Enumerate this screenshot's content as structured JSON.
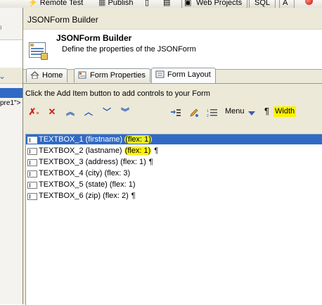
{
  "ide": {
    "toolbar": {
      "remote_test": "Remote Test",
      "publish": "Publish",
      "web_projects": "Web Projects",
      "sql": "SQL"
    },
    "left": {
      "code_fragment": "pre1\">",
      "snippet": "o"
    }
  },
  "dialog": {
    "title": "JSONForm Builder",
    "banner": {
      "heading": "JSONForm Builder",
      "description": "Define the properties of the JSONForm"
    },
    "tabs": [
      {
        "label": "Home",
        "icon": "home-icon",
        "active": false
      },
      {
        "label": "Form Properties",
        "icon": "form-properties-icon",
        "active": false
      },
      {
        "label": "Form Layout",
        "icon": "form-layout-icon",
        "active": true
      }
    ],
    "hint": "Click the Add Item button to add controls to your Form",
    "toolbar": {
      "menu_label": "Menu",
      "pilcrow": "¶",
      "width_label": "Width"
    },
    "items": [
      {
        "name": "TEXTBOX_1 (firstname)",
        "flex": "(flex: 1)",
        "pilcrow": "",
        "selected": true,
        "highlight": true
      },
      {
        "name": "TEXTBOX_2 (lastname)",
        "flex": "(flex: 1)",
        "pilcrow": "¶",
        "selected": false,
        "highlight": true
      },
      {
        "name": "TEXTBOX_3 (address)",
        "flex": "(flex: 1)",
        "pilcrow": "¶",
        "selected": false,
        "highlight": false
      },
      {
        "name": "TEXTBOX_4 (city)",
        "flex": "(flex: 3)",
        "pilcrow": "",
        "selected": false,
        "highlight": false
      },
      {
        "name": "TEXTBOX_5 (state)",
        "flex": "(flex: 1)",
        "pilcrow": "",
        "selected": false,
        "highlight": false
      },
      {
        "name": "TEXTBOX_6 (zip)",
        "flex": "(flex: 2)",
        "pilcrow": "¶",
        "selected": false,
        "highlight": false
      }
    ],
    "colors": {
      "selection": "#316ac5",
      "highlight": "#fff200",
      "dialog_bg": "#ece9d8"
    }
  }
}
